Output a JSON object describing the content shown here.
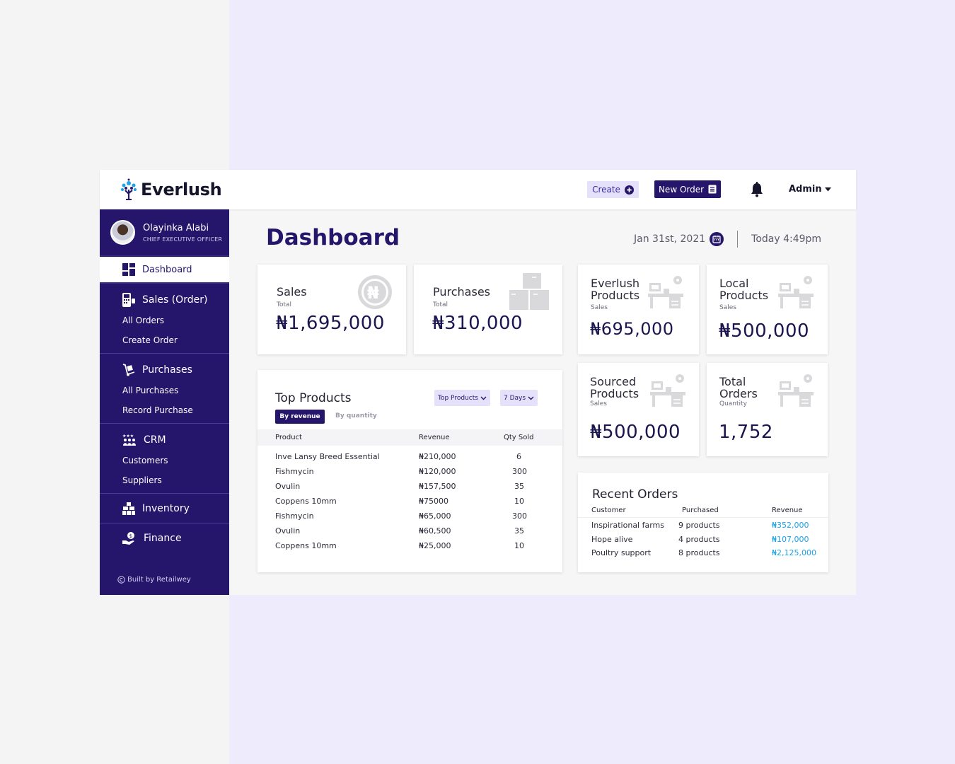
{
  "brand": {
    "name": "Everlush"
  },
  "header": {
    "create_label": "Create",
    "new_order_label": "New Order",
    "admin_label": "Admin"
  },
  "profile": {
    "name": "Olayinka Alabi",
    "role": "CHIEF EXECUTIVE OFFICER"
  },
  "sidebar": {
    "dashboard": "Dashboard",
    "sales": {
      "label": "Sales (Order)",
      "items": [
        "All Orders",
        "Create Order"
      ]
    },
    "purchases": {
      "label": "Purchases",
      "items": [
        "All Purchases",
        "Record Purchase"
      ]
    },
    "crm": {
      "label": "CRM",
      "items": [
        "Customers",
        "Suppliers"
      ]
    },
    "inventory": "Inventory",
    "finance": "Finance",
    "footer": "Built by Retailwey"
  },
  "page": {
    "title": "Dashboard",
    "date": "Jan 31st, 2021",
    "time": "Today 4:49pm"
  },
  "cards": {
    "sales": {
      "title": "Sales",
      "sub": "Total",
      "value": "₦1,695,000"
    },
    "purchases": {
      "title": "Purchases",
      "sub": "Total",
      "value": "₦310,000"
    },
    "everlush": {
      "title1": "Everlush",
      "title2": "Products",
      "sub": "Sales",
      "value": "₦695,000"
    },
    "local": {
      "title1": "Local",
      "title2": "Products",
      "sub": "Sales",
      "value": "₦500,000"
    },
    "sourced": {
      "title1": "Sourced",
      "title2": "Products",
      "sub": "Sales",
      "value": "₦500,000"
    },
    "total_orders": {
      "title1": "Total",
      "title2": "Orders",
      "sub": "Quantity",
      "value": "1,752"
    }
  },
  "top_products": {
    "title": "Top Products",
    "tab_revenue": "By revenue",
    "tab_quantity": "By quantity",
    "filter": "Top Products",
    "period": "7 Days",
    "columns": [
      "Product",
      "Revenue",
      "Qty Sold"
    ],
    "rows": [
      [
        "Inve Lansy Breed Essential",
        "₦210,000",
        "6"
      ],
      [
        "Fishmycin",
        "₦120,000",
        "300"
      ],
      [
        "Ovulin",
        "₦157,500",
        "35"
      ],
      [
        "Coppens 10mm",
        "₦75000",
        "10"
      ],
      [
        "Fishmycin",
        "₦65,000",
        "300"
      ],
      [
        "Ovulin",
        "₦60,500",
        "35"
      ],
      [
        "Coppens 10mm",
        "₦25,000",
        "10"
      ]
    ]
  },
  "recent_orders": {
    "title": "Recent Orders",
    "columns": [
      "Customer",
      "Purchased",
      "Revenue"
    ],
    "rows": [
      [
        "Inspirational farms",
        "9 products",
        "₦352,000"
      ],
      [
        "Hope alive",
        "4 products",
        "₦107,000"
      ],
      [
        "Poultry support",
        "8 products",
        "₦2,125,000"
      ]
    ]
  },
  "colors": {
    "primary": "#25156b",
    "accent_light": "#e6e1fb",
    "link": "#1aa3e8",
    "background": "#eeebfc"
  }
}
